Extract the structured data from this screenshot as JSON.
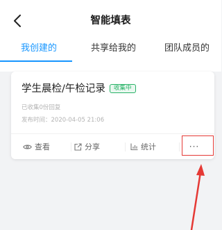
{
  "header": {
    "title": "智能填表",
    "back_icon": "chevron-left-icon"
  },
  "tabs": [
    {
      "label": "我创建的",
      "active": true
    },
    {
      "label": "共享给我的",
      "active": false
    },
    {
      "label": "团队成员的",
      "active": false
    }
  ],
  "card": {
    "title": "学生晨检/午检记录",
    "badge": "收集中",
    "collected": "已收集0份回复",
    "published": "发布时间：2020-04-05 21:06",
    "actions": {
      "view": "查看",
      "share": "分享",
      "stats": "统计",
      "more": "···"
    }
  },
  "colors": {
    "accent": "#1796ff",
    "badge": "#27b266",
    "annotation": "#e53935"
  }
}
